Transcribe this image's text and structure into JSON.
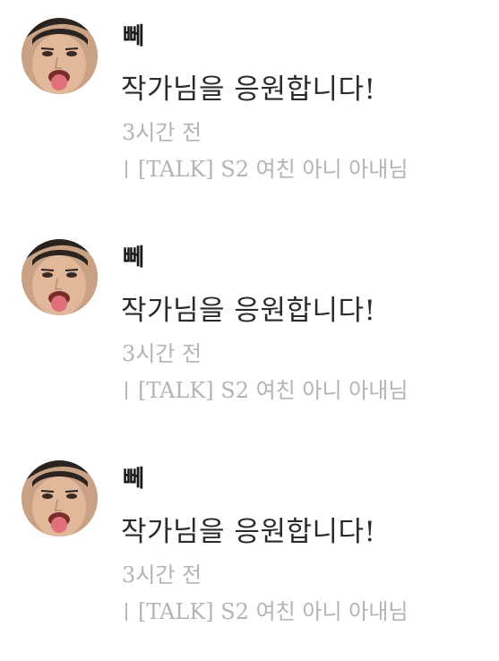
{
  "comments": [
    {
      "author": "뻬",
      "text": "작가님을 응원합니다!",
      "time": "3시간 전",
      "episode": "[TALK] S2 여친 아니 아내님"
    },
    {
      "author": "뻬",
      "text": "작가님을 응원합니다!",
      "time": "3시간 전",
      "episode": "[TALK] S2 여친 아니 아내님"
    },
    {
      "author": "뻬",
      "text": "작가님을 응원합니다!",
      "time": "3시간 전",
      "episode": "[TALK] S2 여친 아니 아내님"
    }
  ],
  "colors": {
    "author": "#1a1a1a",
    "text": "#2b2b2b",
    "meta": "#b4b4b4"
  }
}
